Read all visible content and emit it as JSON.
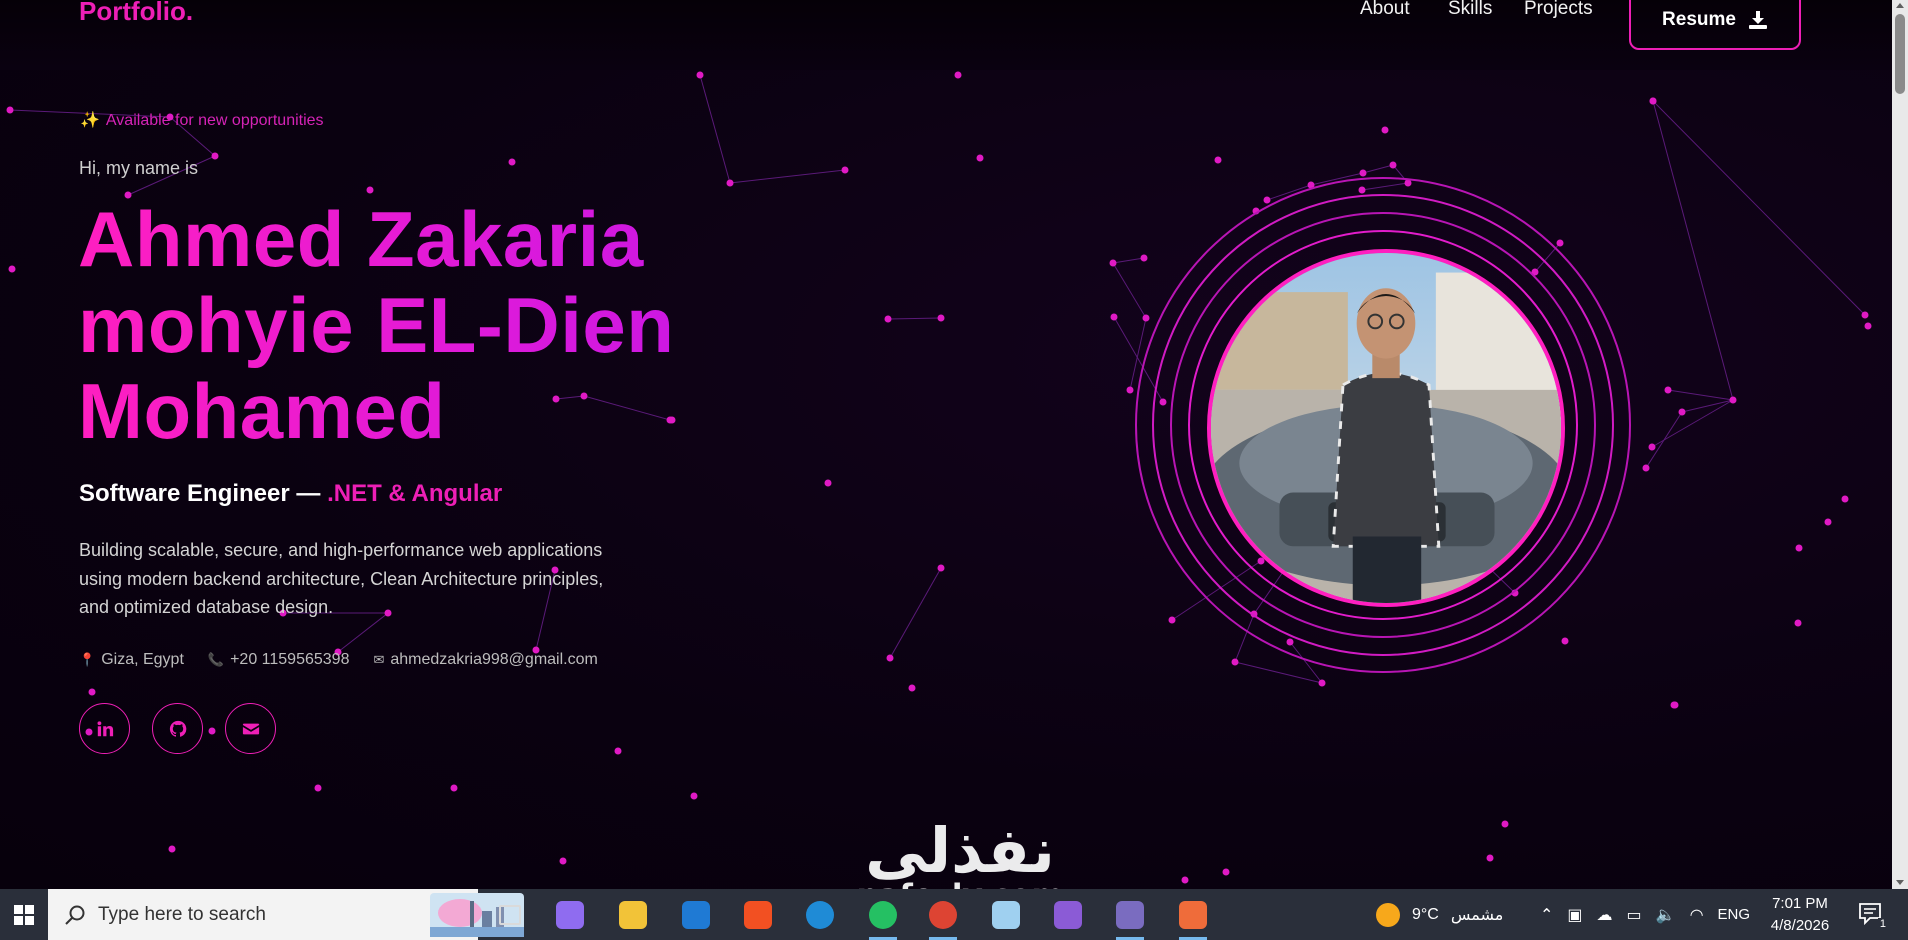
{
  "nav": {
    "logo": "Portfolio.",
    "links": [
      "About",
      "Skills",
      "Projects"
    ],
    "resume_label": "Resume",
    "accent_color": "#ee1fb6"
  },
  "hero": {
    "availability": "Available for new opportunities",
    "greeting": "Hi, my name is",
    "name_lines": [
      "Ahmed Zakaria",
      "mohyie EL-Dien",
      "Mohamed"
    ],
    "role_prefix": "Software Engineer —",
    "role_accent": ".NET & Angular",
    "bio": "Building scalable, secure, and high-performance web applications using modern backend architecture, Clean Architecture principles, and optimized database design.",
    "location": "Giza, Egypt",
    "phone": "+20 1159565398",
    "email": "ahmedzakria998@gmail.com",
    "socials": [
      "linkedin-icon",
      "github-icon",
      "envelope-icon"
    ]
  },
  "watermark": {
    "arabic": "نفذلى",
    "latin": "nafezly.com"
  },
  "taskbar": {
    "search_placeholder": "Type here to search",
    "weather_temp": "9°C",
    "weather_desc": "مشمس",
    "language": "ENG",
    "time": "7:01 PM",
    "date": "4/8/2026",
    "notification_count": "1",
    "apps": [
      "task-view-icon",
      "copilot-icon",
      "file-explorer-icon",
      "outlook-icon",
      "store-icon",
      "edge-icon",
      "whatsapp-icon",
      "chrome-icon",
      "notepad-icon",
      "visual-studio-icon",
      "terminal-icon",
      "postman-icon"
    ]
  }
}
